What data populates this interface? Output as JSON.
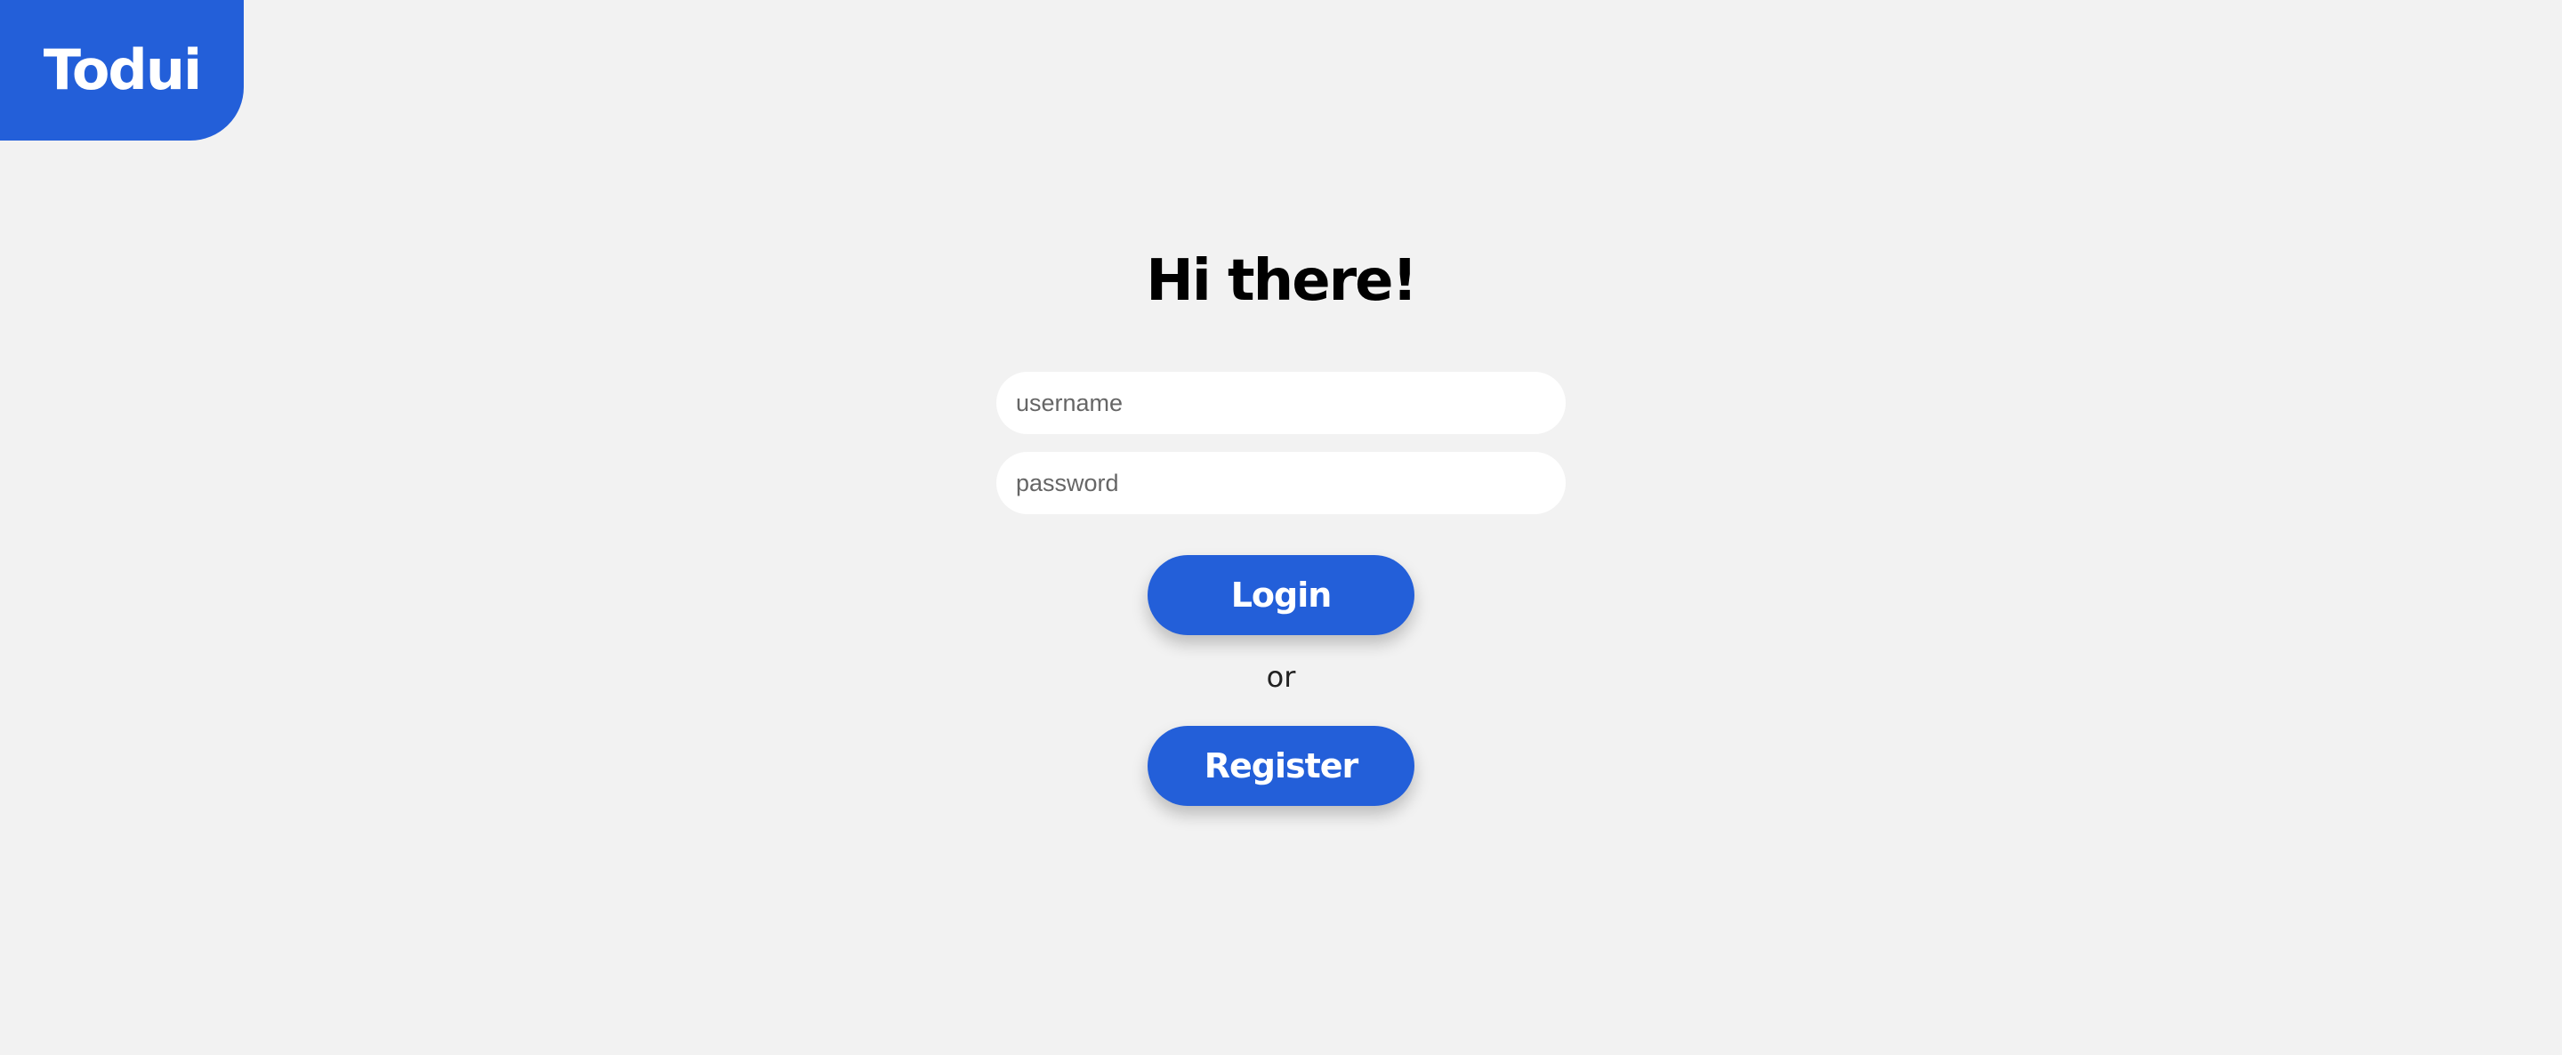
{
  "brand": {
    "name": "Todui",
    "color": "#235fd9"
  },
  "login": {
    "heading": "Hi there!",
    "username_placeholder": "username",
    "password_placeholder": "password",
    "login_label": "Login",
    "separator": "or",
    "register_label": "Register"
  },
  "colors": {
    "background": "#f2f2f2",
    "accent": "#235fd9",
    "input_background": "#ffffff"
  }
}
